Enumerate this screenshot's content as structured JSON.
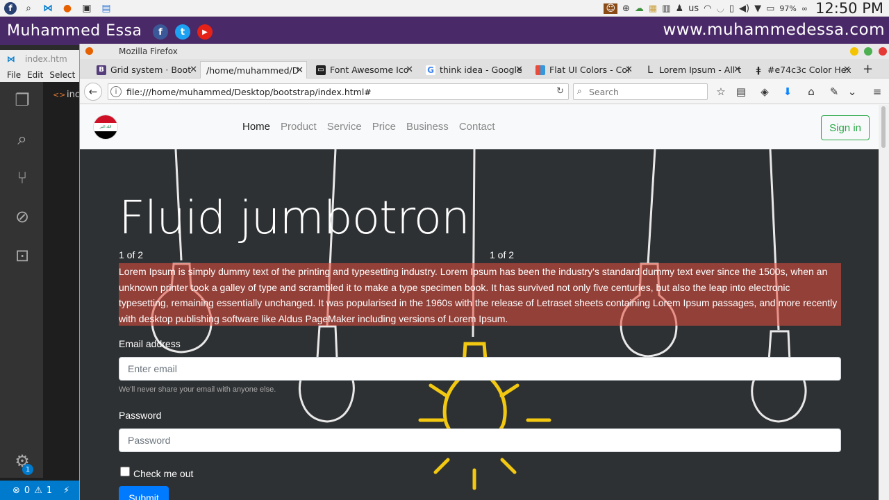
{
  "system_panel": {
    "keyboard_layout": "us",
    "battery": "97%",
    "battery_extra": "∞",
    "clock": "12:50 PM"
  },
  "banner": {
    "name": "Muhammed Essa",
    "url": "www.muhammedessa.com",
    "social": [
      "f",
      "t",
      "▶"
    ],
    "bg_color": "#4a2968"
  },
  "vscode": {
    "tab": "index.htm",
    "menu": [
      "File",
      "Edit",
      "Select"
    ],
    "editor_tab": "inc",
    "status_errors": "0",
    "status_warnings": "1",
    "settings_badge": "1",
    "accent": "#007acc"
  },
  "firefox": {
    "window_title": "Mozilla Firefox",
    "tabs": [
      {
        "label": "Grid system · Boot",
        "icon": "bootstrap-icon"
      },
      {
        "label": "/home/muhammed/D",
        "icon": "none"
      },
      {
        "label": "Font Awesome Ico",
        "icon": "font-awesome-icon"
      },
      {
        "label": "think idea - Google",
        "icon": "google-icon"
      },
      {
        "label": "Flat UI Colors - Col",
        "icon": "flat-ui-icon"
      },
      {
        "label": "Lorem Ipsum - All t",
        "icon": "lorem-icon"
      },
      {
        "label": "#e74c3c Color Hex",
        "icon": "colorhex-icon"
      }
    ],
    "url": "file:///home/muhammed/Desktop/bootstrap/index.html#",
    "search_placeholder": "Search"
  },
  "page": {
    "nav": {
      "brand": "Iraq flag logo",
      "links": [
        "Home",
        "Product",
        "Service",
        "Price",
        "Business",
        "Contact"
      ],
      "active": "Home",
      "signin": "Sign in"
    },
    "jumbotron": {
      "title": "Fluid jumbotron",
      "pager_left": "1 of 2",
      "pager_right": "1 of 2",
      "lead": "Lorem Ipsum is simply dummy text of the printing and typesetting industry. Lorem Ipsum has been the industry's standard dummy text ever since the 1500s, when an unknown printer took a galley of type and scrambled it to make a type specimen book. It has survived not only five centuries, but also the leap into electronic typesetting, remaining essentially unchanged. It was popularised in the 1960s with the release of Letraset sheets containing Lorem Ipsum passages, and more recently with desktop publishing software like Aldus PageMaker including versions of Lorem Ipsum.",
      "lead_bg": "#e74c3c"
    },
    "form": {
      "email_label": "Email address",
      "email_placeholder": "Enter email",
      "email_help": "We'll never share your email with anyone else.",
      "password_label": "Password",
      "password_placeholder": "Password",
      "check_label": "Check me out",
      "submit": "Submit"
    }
  }
}
